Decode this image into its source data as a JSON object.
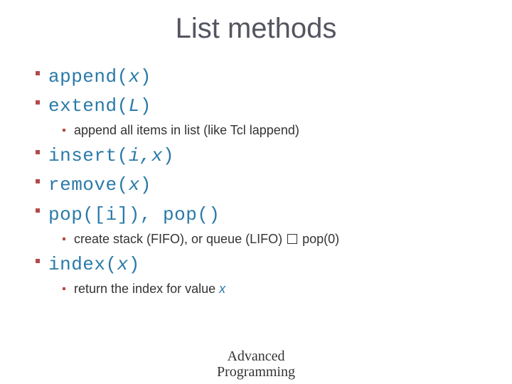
{
  "title": "List methods",
  "items": [
    {
      "method": "append",
      "params": "x"
    },
    {
      "method": "extend",
      "params": "L",
      "sub": "append all items in list (like Tcl lappend)"
    },
    {
      "method": "insert",
      "params": "i,x"
    },
    {
      "method": "remove",
      "params": "x"
    },
    {
      "method_raw": "pop([i]), pop()",
      "sub_pre": "create stack (FIFO), or queue (LIFO) ",
      "sub_post": " pop(0)"
    },
    {
      "method": "index",
      "params": "x",
      "sub_pre2": "return the index for value ",
      "sub_param": "x"
    }
  ],
  "footer_line1": "Advanced",
  "footer_line2": "Programming"
}
